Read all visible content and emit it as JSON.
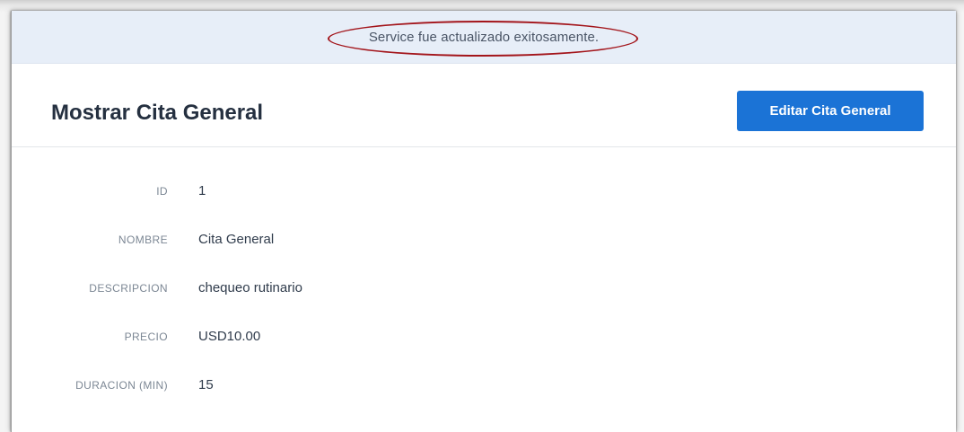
{
  "flash": {
    "message": "Service fue actualizado exitosamente."
  },
  "header": {
    "title": "Mostrar Cita General",
    "edit_button_label": "Editar Cita General"
  },
  "details": [
    {
      "label": "ID",
      "value": "1"
    },
    {
      "label": "NOMBRE",
      "value": "Cita General"
    },
    {
      "label": "DESCRIPCION",
      "value": "chequeo rutinario"
    },
    {
      "label": "PRECIO",
      "value": "USD10.00"
    },
    {
      "label": "DURACION (MIN)",
      "value": "15"
    }
  ],
  "colors": {
    "primary_button": "#1b73d6",
    "flash_background": "#e7eef8",
    "annotation_ellipse": "#a3151b",
    "title_text": "#253040"
  }
}
